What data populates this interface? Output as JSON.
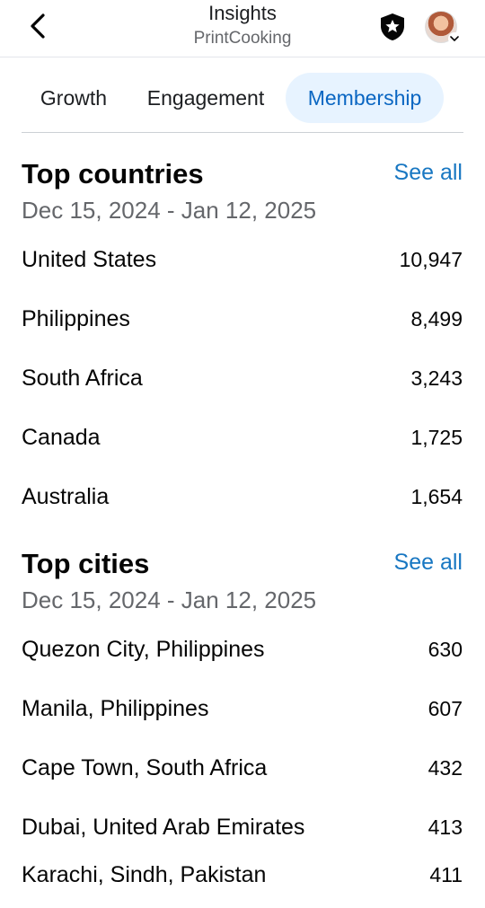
{
  "header": {
    "title": "Insights",
    "subtitle": "PrintCooking",
    "back_icon": "chevron-left-icon",
    "shield_icon": "shield-star-icon",
    "avatar_icon": "profile-avatar"
  },
  "tabs": [
    {
      "label": "Growth",
      "active": false
    },
    {
      "label": "Engagement",
      "active": false
    },
    {
      "label": "Membership",
      "active": true
    }
  ],
  "colors": {
    "accent": "#1877c2",
    "active_tab_bg": "#e7f3ff",
    "active_tab_text": "#0a66c2",
    "secondary_text": "#65676b"
  },
  "top_countries": {
    "title": "Top countries",
    "see_all": "See all",
    "date_range": "Dec 15, 2024 - Jan 12, 2025",
    "items": [
      {
        "name": "United States",
        "value": "10,947"
      },
      {
        "name": "Philippines",
        "value": "8,499"
      },
      {
        "name": "South Africa",
        "value": "3,243"
      },
      {
        "name": "Canada",
        "value": "1,725"
      },
      {
        "name": "Australia",
        "value": "1,654"
      }
    ]
  },
  "top_cities": {
    "title": "Top cities",
    "see_all": "See all",
    "date_range": "Dec 15, 2024 - Jan 12, 2025",
    "items": [
      {
        "name": "Quezon City, Philippines",
        "value": "630"
      },
      {
        "name": "Manila, Philippines",
        "value": "607"
      },
      {
        "name": "Cape Town, South Africa",
        "value": "432"
      },
      {
        "name": "Dubai, United Arab Emirates",
        "value": "413"
      },
      {
        "name": "Karachi, Sindh, Pakistan",
        "value": "411"
      }
    ]
  }
}
